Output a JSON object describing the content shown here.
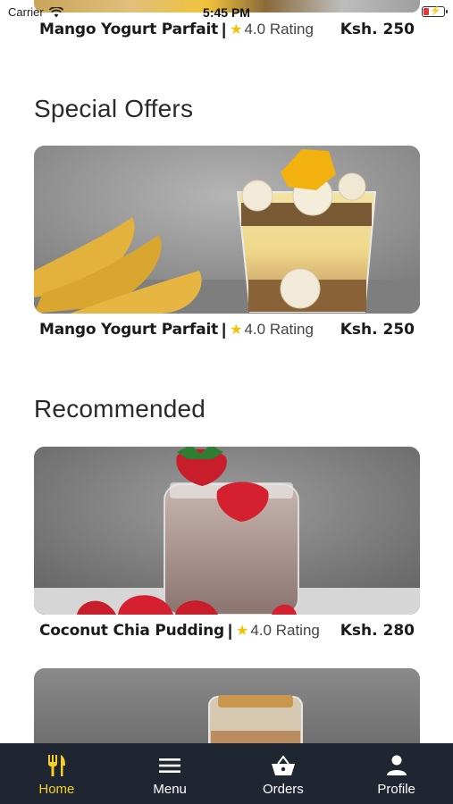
{
  "status_bar": {
    "carrier": "Carrier",
    "time": "5:45 PM"
  },
  "colors": {
    "accent": "#f5d020",
    "tab_bar_bg": "#1f2632",
    "star": "#f2c200",
    "battery_low": "#e53935"
  },
  "top_item": {
    "name": "Mango Yogurt Parfait",
    "separator": "|",
    "rating": "4.0 Rating",
    "price": "Ksh. 250"
  },
  "special_offers": {
    "title": "Special Offers",
    "item": {
      "name": "Mango Yogurt Parfait",
      "separator": "|",
      "rating": "4.0 Rating",
      "price": "Ksh. 250"
    }
  },
  "recommended": {
    "title": "Recommended",
    "item": {
      "name": "Coconut Chia Pudding",
      "separator": "|",
      "rating": "4.0 Rating",
      "price": "Ksh. 280"
    }
  },
  "tab_bar": {
    "tabs": [
      {
        "label": "Home",
        "icon": "fork-knife-icon",
        "active": true
      },
      {
        "label": "Menu",
        "icon": "hamburger-menu-icon",
        "active": false
      },
      {
        "label": "Orders",
        "icon": "basket-icon",
        "active": false
      },
      {
        "label": "Profile",
        "icon": "person-icon",
        "active": false
      }
    ]
  }
}
